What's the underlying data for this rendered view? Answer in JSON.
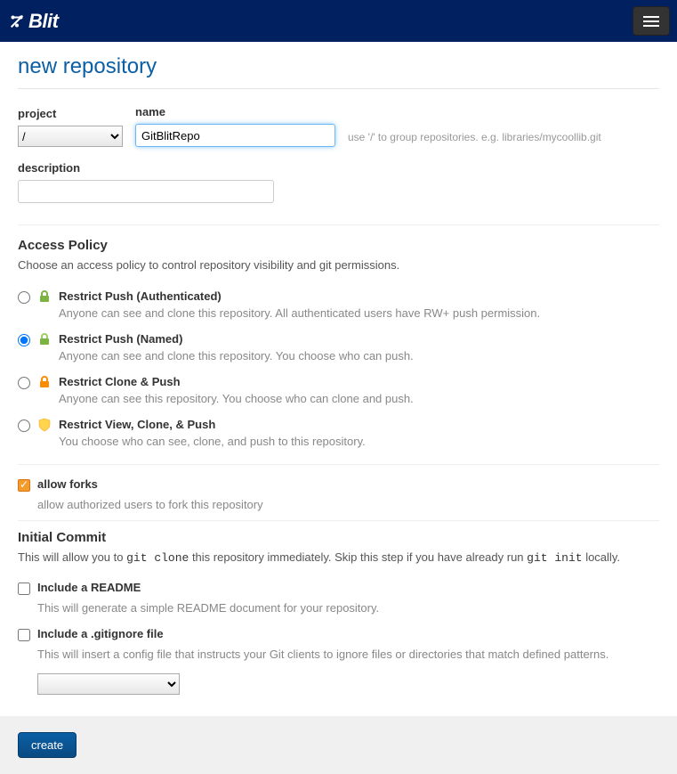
{
  "brand": "Blit",
  "page_title": "new repository",
  "project": {
    "label": "project",
    "value": "/"
  },
  "name": {
    "label": "name",
    "value": "GitBlitRepo",
    "hint": "use '/' to group repositories. e.g. libraries/mycoollib.git"
  },
  "description": {
    "label": "description",
    "value": ""
  },
  "access_policy": {
    "title": "Access Policy",
    "subtitle": "Choose an access policy to control repository visibility and git permissions.",
    "options": [
      {
        "label": "Restrict Push (Authenticated)",
        "desc": "Anyone can see and clone this repository. All authenticated users have RW+ push permission.",
        "checked": false
      },
      {
        "label": "Restrict Push (Named)",
        "desc": "Anyone can see and clone this repository. You choose who can push.",
        "checked": true
      },
      {
        "label": "Restrict Clone & Push",
        "desc": "Anyone can see this repository. You choose who can clone and push.",
        "checked": false
      },
      {
        "label": "Restrict View, Clone, & Push",
        "desc": "You choose who can see, clone, and push to this repository.",
        "checked": false
      }
    ]
  },
  "allow_forks": {
    "label": "allow forks",
    "desc": "allow authorized users to fork this repository",
    "checked": true
  },
  "initial_commit": {
    "title": "Initial Commit",
    "text_pre": "This will allow you to ",
    "code1": "git clone",
    "text_mid": " this repository immediately. Skip this step if you have already run ",
    "code2": "git init",
    "text_post": " locally."
  },
  "readme": {
    "label": "Include a README",
    "desc": "This will generate a simple README document for your repository.",
    "checked": false
  },
  "gitignore": {
    "label": "Include a .gitignore file",
    "desc": "This will insert a config file that instructs your Git clients to ignore files or directories that match defined patterns.",
    "checked": false,
    "selected": ""
  },
  "create_button": "create"
}
